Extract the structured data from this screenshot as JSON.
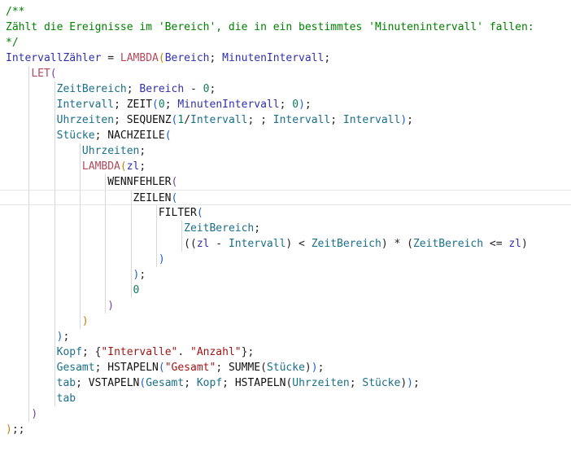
{
  "colors": {
    "comment": "#008000",
    "function": "#111111",
    "parameter": "#3030b0",
    "variable": "#1a6f8a",
    "lambda": "#b5485a",
    "string": "#a31515",
    "number": "#0d7a5f",
    "bracket_1": "#b8860b",
    "bracket_2": "#7b3fa0",
    "bracket_3": "#1f5fd0"
  },
  "lines": [
    [
      {
        "t": "/**",
        "c": "comment"
      }
    ],
    [
      {
        "t": "Zählt die Ereignisse im 'Bereich', die in ein bestimmtes 'Minutenintervall' fallen:",
        "c": "comment"
      }
    ],
    [
      {
        "t": "*/",
        "c": "comment"
      }
    ],
    [
      {
        "t": "IntervallZähler",
        "c": "param"
      },
      {
        "t": " = ",
        "c": "op"
      },
      {
        "t": "LAMBDA",
        "c": "lambda"
      },
      {
        "t": "(",
        "c": "br1"
      },
      {
        "t": "Bereich",
        "c": "param"
      },
      {
        "t": "; ",
        "c": "op"
      },
      {
        "t": "MinutenIntervall",
        "c": "param"
      },
      {
        "t": ";",
        "c": "op"
      }
    ],
    [
      {
        "t": "    ",
        "c": "op"
      },
      {
        "t": "LET",
        "c": "lambda"
      },
      {
        "t": "(",
        "c": "br2"
      }
    ],
    [
      {
        "t": "        ",
        "c": "op"
      },
      {
        "t": "ZeitBereich",
        "c": "id"
      },
      {
        "t": "; ",
        "c": "op"
      },
      {
        "t": "Bereich",
        "c": "param"
      },
      {
        "t": " - ",
        "c": "op"
      },
      {
        "t": "0",
        "c": "num"
      },
      {
        "t": ";",
        "c": "op"
      }
    ],
    [
      {
        "t": "        ",
        "c": "op"
      },
      {
        "t": "Intervall",
        "c": "id"
      },
      {
        "t": "; ",
        "c": "op"
      },
      {
        "t": "ZEIT",
        "c": "fn"
      },
      {
        "t": "(",
        "c": "br3"
      },
      {
        "t": "0",
        "c": "num"
      },
      {
        "t": "; ",
        "c": "op"
      },
      {
        "t": "MinutenIntervall",
        "c": "param"
      },
      {
        "t": "; ",
        "c": "op"
      },
      {
        "t": "0",
        "c": "num"
      },
      {
        "t": ")",
        "c": "br3"
      },
      {
        "t": ";",
        "c": "op"
      }
    ],
    [
      {
        "t": "        ",
        "c": "op"
      },
      {
        "t": "Uhrzeiten",
        "c": "id"
      },
      {
        "t": "; ",
        "c": "op"
      },
      {
        "t": "SEQUENZ",
        "c": "fn"
      },
      {
        "t": "(",
        "c": "br3"
      },
      {
        "t": "1",
        "c": "num"
      },
      {
        "t": "/",
        "c": "op"
      },
      {
        "t": "Intervall",
        "c": "id"
      },
      {
        "t": "; ; ",
        "c": "op"
      },
      {
        "t": "Intervall",
        "c": "id"
      },
      {
        "t": "; ",
        "c": "op"
      },
      {
        "t": "Intervall",
        "c": "id"
      },
      {
        "t": ")",
        "c": "br3"
      },
      {
        "t": ";",
        "c": "op"
      }
    ],
    [
      {
        "t": "        ",
        "c": "op"
      },
      {
        "t": "Stücke",
        "c": "id"
      },
      {
        "t": "; ",
        "c": "op"
      },
      {
        "t": "NACHZEILE",
        "c": "fn"
      },
      {
        "t": "(",
        "c": "br3"
      }
    ],
    [
      {
        "t": "            ",
        "c": "op"
      },
      {
        "t": "Uhrzeiten",
        "c": "id"
      },
      {
        "t": ";",
        "c": "op"
      }
    ],
    [
      {
        "t": "            ",
        "c": "op"
      },
      {
        "t": "LAMBDA",
        "c": "lambda"
      },
      {
        "t": "(",
        "c": "br1"
      },
      {
        "t": "zl",
        "c": "param"
      },
      {
        "t": ";",
        "c": "op"
      }
    ],
    [
      {
        "t": "                ",
        "c": "op"
      },
      {
        "t": "WENNFEHLER",
        "c": "fn"
      },
      {
        "t": "(",
        "c": "br2"
      }
    ],
    [
      {
        "t": "                    ",
        "c": "op"
      },
      {
        "t": "ZEILEN",
        "c": "fn"
      },
      {
        "t": "(",
        "c": "br3"
      }
    ],
    [
      {
        "t": "                        ",
        "c": "op"
      },
      {
        "t": "FILTER",
        "c": "fn"
      },
      {
        "t": "(",
        "c": "br3"
      }
    ],
    [
      {
        "t": "                            ",
        "c": "op"
      },
      {
        "t": "ZeitBereich",
        "c": "id"
      },
      {
        "t": ";",
        "c": "op"
      }
    ],
    [
      {
        "t": "                            ",
        "c": "op"
      },
      {
        "t": "((",
        "c": "op"
      },
      {
        "t": "zl",
        "c": "param"
      },
      {
        "t": " - ",
        "c": "op"
      },
      {
        "t": "Intervall",
        "c": "id"
      },
      {
        "t": ") < ",
        "c": "op"
      },
      {
        "t": "ZeitBereich",
        "c": "id"
      },
      {
        "t": ") * (",
        "c": "op"
      },
      {
        "t": "ZeitBereich",
        "c": "id"
      },
      {
        "t": " <= ",
        "c": "op"
      },
      {
        "t": "zl",
        "c": "param"
      },
      {
        "t": ")",
        "c": "op"
      }
    ],
    [
      {
        "t": "                        ",
        "c": "op"
      },
      {
        "t": ")",
        "c": "br3"
      }
    ],
    [
      {
        "t": "                    ",
        "c": "op"
      },
      {
        "t": ")",
        "c": "br3"
      },
      {
        "t": ";",
        "c": "op"
      }
    ],
    [
      {
        "t": "                    ",
        "c": "op"
      },
      {
        "t": "0",
        "c": "num"
      }
    ],
    [
      {
        "t": "                ",
        "c": "op"
      },
      {
        "t": ")",
        "c": "br2"
      }
    ],
    [
      {
        "t": "            ",
        "c": "op"
      },
      {
        "t": ")",
        "c": "br1"
      }
    ],
    [
      {
        "t": "        ",
        "c": "op"
      },
      {
        "t": ")",
        "c": "br3"
      },
      {
        "t": ";",
        "c": "op"
      }
    ],
    [
      {
        "t": "        ",
        "c": "op"
      },
      {
        "t": "Kopf",
        "c": "id"
      },
      {
        "t": "; {",
        "c": "op"
      },
      {
        "t": "\"Intervalle\"",
        "c": "str"
      },
      {
        "t": ". ",
        "c": "op"
      },
      {
        "t": "\"Anzahl\"",
        "c": "str"
      },
      {
        "t": "};",
        "c": "op"
      }
    ],
    [
      {
        "t": "        ",
        "c": "op"
      },
      {
        "t": "Gesamt",
        "c": "id"
      },
      {
        "t": "; ",
        "c": "op"
      },
      {
        "t": "HSTAPELN",
        "c": "fn"
      },
      {
        "t": "(",
        "c": "br3"
      },
      {
        "t": "\"Gesamt\"",
        "c": "str"
      },
      {
        "t": "; ",
        "c": "op"
      },
      {
        "t": "SUMME",
        "c": "fn"
      },
      {
        "t": "(",
        "c": "op"
      },
      {
        "t": "Stücke",
        "c": "id"
      },
      {
        "t": ")",
        "c": "op"
      },
      {
        "t": ")",
        "c": "br3"
      },
      {
        "t": ";",
        "c": "op"
      }
    ],
    [
      {
        "t": "        ",
        "c": "op"
      },
      {
        "t": "tab",
        "c": "id"
      },
      {
        "t": "; ",
        "c": "op"
      },
      {
        "t": "VSTAPELN",
        "c": "fn"
      },
      {
        "t": "(",
        "c": "br3"
      },
      {
        "t": "Gesamt",
        "c": "id"
      },
      {
        "t": "; ",
        "c": "op"
      },
      {
        "t": "Kopf",
        "c": "id"
      },
      {
        "t": "; ",
        "c": "op"
      },
      {
        "t": "HSTAPELN",
        "c": "fn"
      },
      {
        "t": "(",
        "c": "op"
      },
      {
        "t": "Uhrzeiten",
        "c": "id"
      },
      {
        "t": "; ",
        "c": "op"
      },
      {
        "t": "Stücke",
        "c": "id"
      },
      {
        "t": ")",
        "c": "op"
      },
      {
        "t": ")",
        "c": "br3"
      },
      {
        "t": ";",
        "c": "op"
      }
    ],
    [
      {
        "t": "        ",
        "c": "op"
      },
      {
        "t": "tab",
        "c": "id"
      }
    ],
    [
      {
        "t": "    ",
        "c": "op"
      },
      {
        "t": ")",
        "c": "br2"
      }
    ],
    [
      {
        "t": ")",
        "c": "br1"
      },
      {
        "t": ";;",
        "c": "op"
      }
    ]
  ]
}
